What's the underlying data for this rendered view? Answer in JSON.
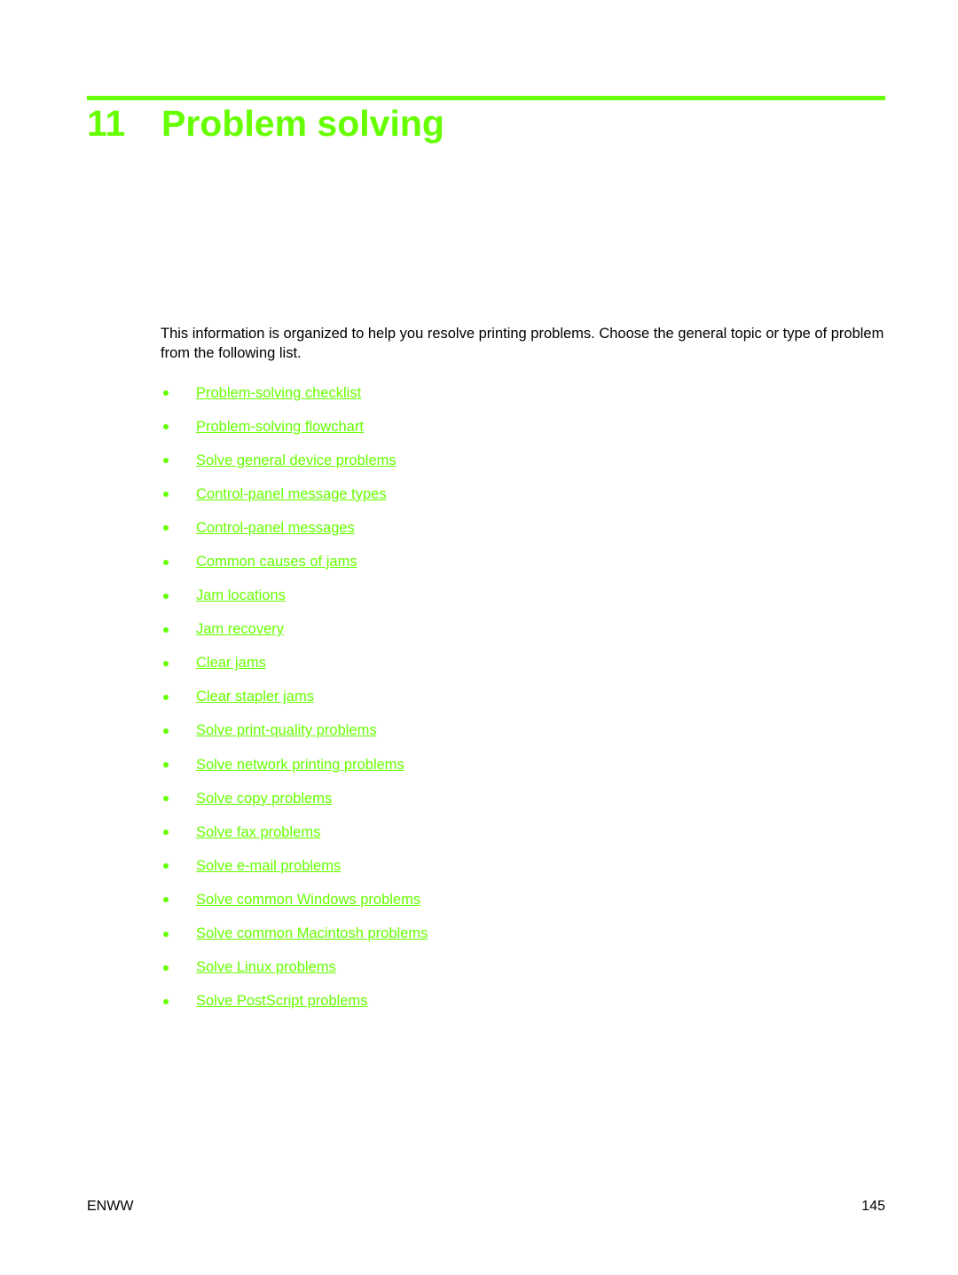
{
  "chapter": {
    "number": "11",
    "title": "Problem solving",
    "accent_color": "#66ff00"
  },
  "intro": "This information is organized to help you resolve printing problems. Choose the general topic or type of problem from the following list.",
  "topics": [
    "Problem-solving checklist",
    "Problem-solving flowchart",
    "Solve general device problems",
    "Control-panel message types",
    "Control-panel messages",
    "Common causes of jams",
    "Jam locations",
    "Jam recovery",
    "Clear jams",
    "Clear stapler jams",
    "Solve print-quality problems",
    "Solve network printing problems",
    "Solve copy problems",
    "Solve fax problems",
    "Solve e-mail problems",
    "Solve common Windows problems ",
    "Solve common Macintosh problems",
    "Solve Linux problems",
    "Solve PostScript problems"
  ],
  "footer": {
    "left": "ENWW",
    "page": "145"
  }
}
